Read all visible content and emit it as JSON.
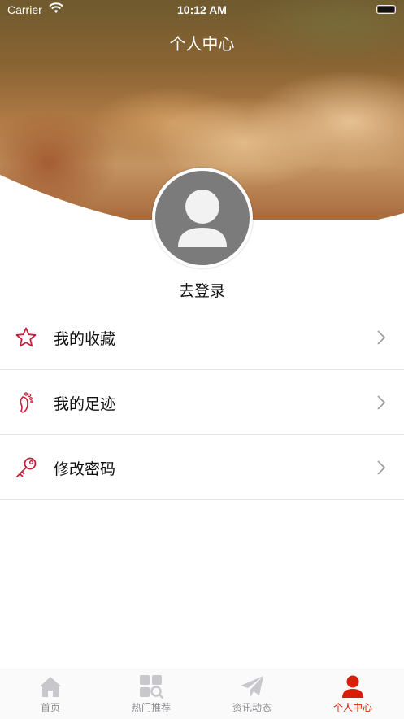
{
  "status_bar": {
    "carrier": "Carrier",
    "time": "10:12 AM"
  },
  "header": {
    "title": "个人中心"
  },
  "profile": {
    "login_label": "去登录"
  },
  "menu": [
    {
      "label": "我的收藏",
      "icon": "star-icon"
    },
    {
      "label": "我的足迹",
      "icon": "footprint-icon"
    },
    {
      "label": "修改密码",
      "icon": "key-icon"
    }
  ],
  "tabbar": [
    {
      "label": "首页",
      "icon": "home-icon",
      "active": false
    },
    {
      "label": "热门推荐",
      "icon": "grid-search-icon",
      "active": false
    },
    {
      "label": "资讯动态",
      "icon": "paper-plane-icon",
      "active": false
    },
    {
      "label": "个人中心",
      "icon": "person-icon",
      "active": true
    }
  ],
  "colors": {
    "accent": "#d81e06",
    "icon_line": "#c8203a",
    "inactive": "#8e8e93",
    "avatar_bg": "#7b7b7b"
  }
}
